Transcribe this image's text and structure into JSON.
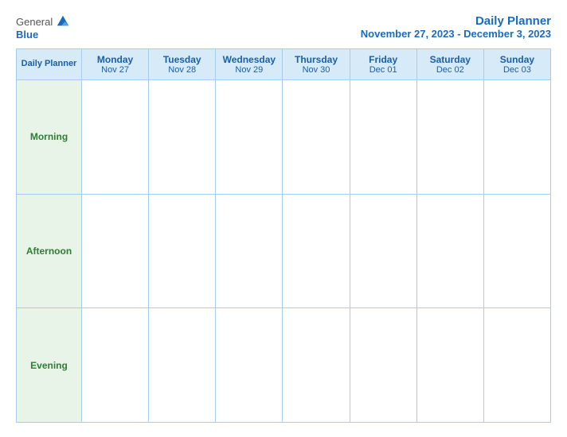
{
  "header": {
    "logo_general": "General",
    "logo_blue": "Blue",
    "title_main": "Daily Planner",
    "title_sub": "November 27, 2023 - December 3, 2023"
  },
  "table": {
    "first_col_label": "Daily Planner",
    "days": [
      {
        "name": "Monday",
        "date": "Nov 27"
      },
      {
        "name": "Tuesday",
        "date": "Nov 28"
      },
      {
        "name": "Wednesday",
        "date": "Nov 29"
      },
      {
        "name": "Thursday",
        "date": "Nov 30"
      },
      {
        "name": "Friday",
        "date": "Dec 01"
      },
      {
        "name": "Saturday",
        "date": "Dec 02"
      },
      {
        "name": "Sunday",
        "date": "Dec 03"
      }
    ],
    "rows": [
      {
        "label": "Morning"
      },
      {
        "label": "Afternoon"
      },
      {
        "label": "Evening"
      }
    ]
  }
}
